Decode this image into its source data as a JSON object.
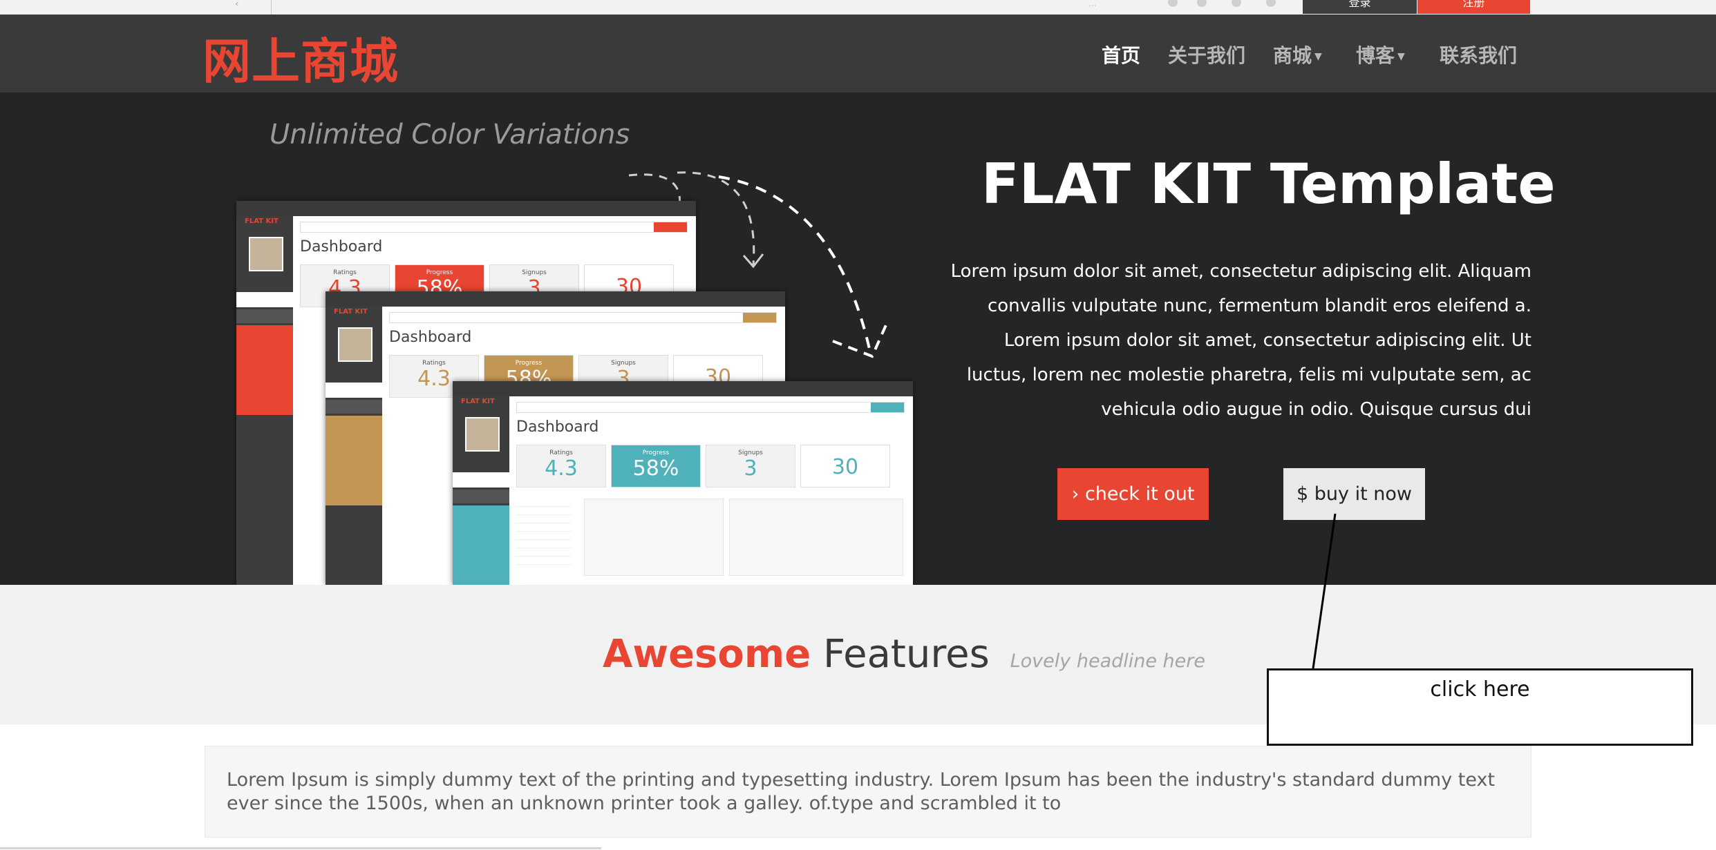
{
  "topbar": {
    "faded_text": "...",
    "login_label": "登录",
    "register_label": "注册"
  },
  "nav": {
    "logo": "网上商城",
    "items": [
      {
        "label": "首页",
        "active": true
      },
      {
        "label": "关于我们"
      },
      {
        "label": "商城",
        "dropdown": true
      },
      {
        "label": "博客",
        "dropdown": true
      },
      {
        "label": "联系我们"
      }
    ]
  },
  "hero": {
    "tagline": "Unlimited Color Variations",
    "title": "FLAT KIT Template",
    "text": "Lorem ipsum dolor sit amet, consectetur adipiscing elit. Aliquam convallis vulputate nunc, fermentum blandit eros eleifend a. Lorem ipsum dolor sit amet, consectetur adipiscing elit. Ut luctus, lorem nec molestie pharetra, felis mi vulputate sem, ac vehicula odio augue in odio. Quisque cursus dui",
    "check_label": "check it out",
    "check_icon": "›",
    "buy_label": "buy it now",
    "buy_icon": "$",
    "mockup": {
      "brand": "FLAT KIT",
      "title": "Dashboard",
      "ratings_label": "Ratings",
      "ratings_value": "4.3",
      "progress_label": "Progress",
      "progress_value": "58%",
      "signups_label": "Signups",
      "signups_value": "3",
      "count_value": "30",
      "accent_colors": [
        "#e84532",
        "#c49654",
        "#4fb1ba"
      ]
    }
  },
  "features": {
    "accent": "Awesome",
    "title": "Features",
    "subtitle": "Lovely headline here"
  },
  "lorem": "Lorem Ipsum is simply dummy text of the printing and typesetting industry. Lorem Ipsum has been the industry's standard dummy text ever since the 1500s, when an unknown printer took a galley. of.type and scrambled it to",
  "annotation": {
    "label": "click here"
  }
}
